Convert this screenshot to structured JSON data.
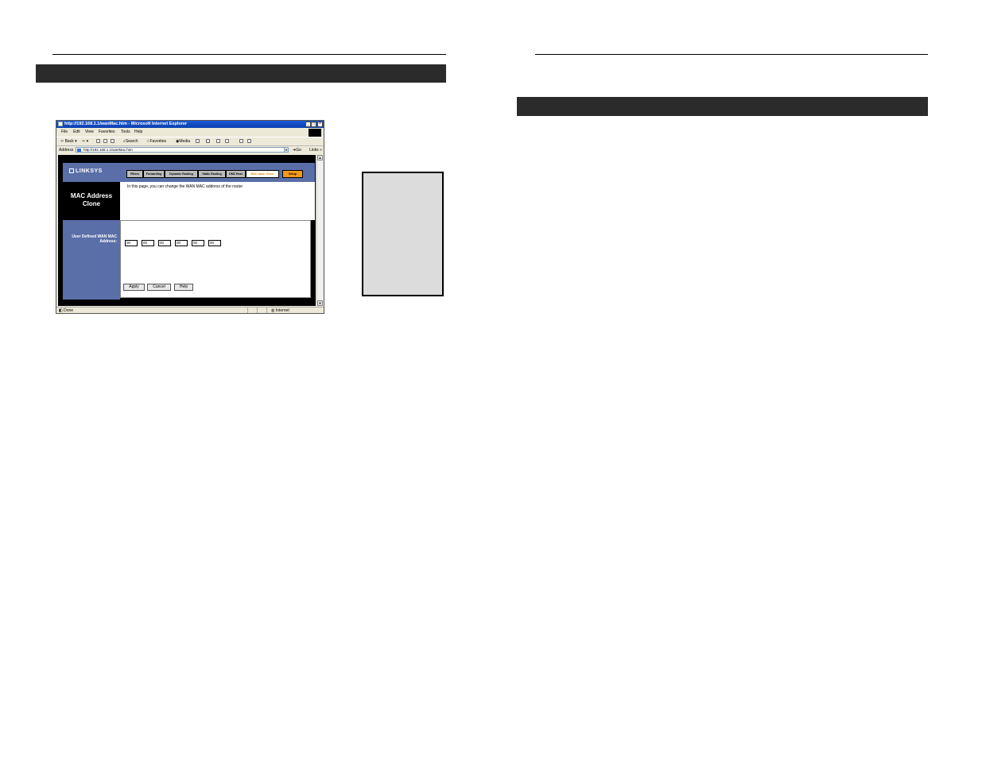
{
  "browser": {
    "title": "http://192.168.1.1/wanMac.htm - Microsoft Internet Explorer",
    "menu": [
      "File",
      "Edit",
      "View",
      "Favorites",
      "Tools",
      "Help"
    ],
    "toolbar": {
      "back": "Back",
      "search": "Search",
      "favorites": "Favorites",
      "media": "Media"
    },
    "address_label": "Address",
    "address_value": "http://192.168.1.1/wanMac.htm",
    "go_label": "Go",
    "links_label": "Links",
    "status_left": "Done",
    "status_zone": "Internet"
  },
  "router": {
    "logo": "LINKSYS",
    "tabs": [
      "Filters",
      "Forwarding",
      "Dynamic Routing",
      "Static Routing",
      "DMZ Host",
      "MAC Addr. Clone",
      "Setup"
    ],
    "active_tab_index": 5,
    "section_title": "MAC Address Clone",
    "description": "In this page, you can change the WAN MAC address of the router",
    "field_label": "User Defined WAN MAC Address:",
    "mac_octets": [
      "00",
      "00",
      "00",
      "00",
      "00",
      "00"
    ],
    "separator": ".",
    "buttons": {
      "apply": "Apply",
      "cancel": "Cancel",
      "help": "Help"
    }
  }
}
